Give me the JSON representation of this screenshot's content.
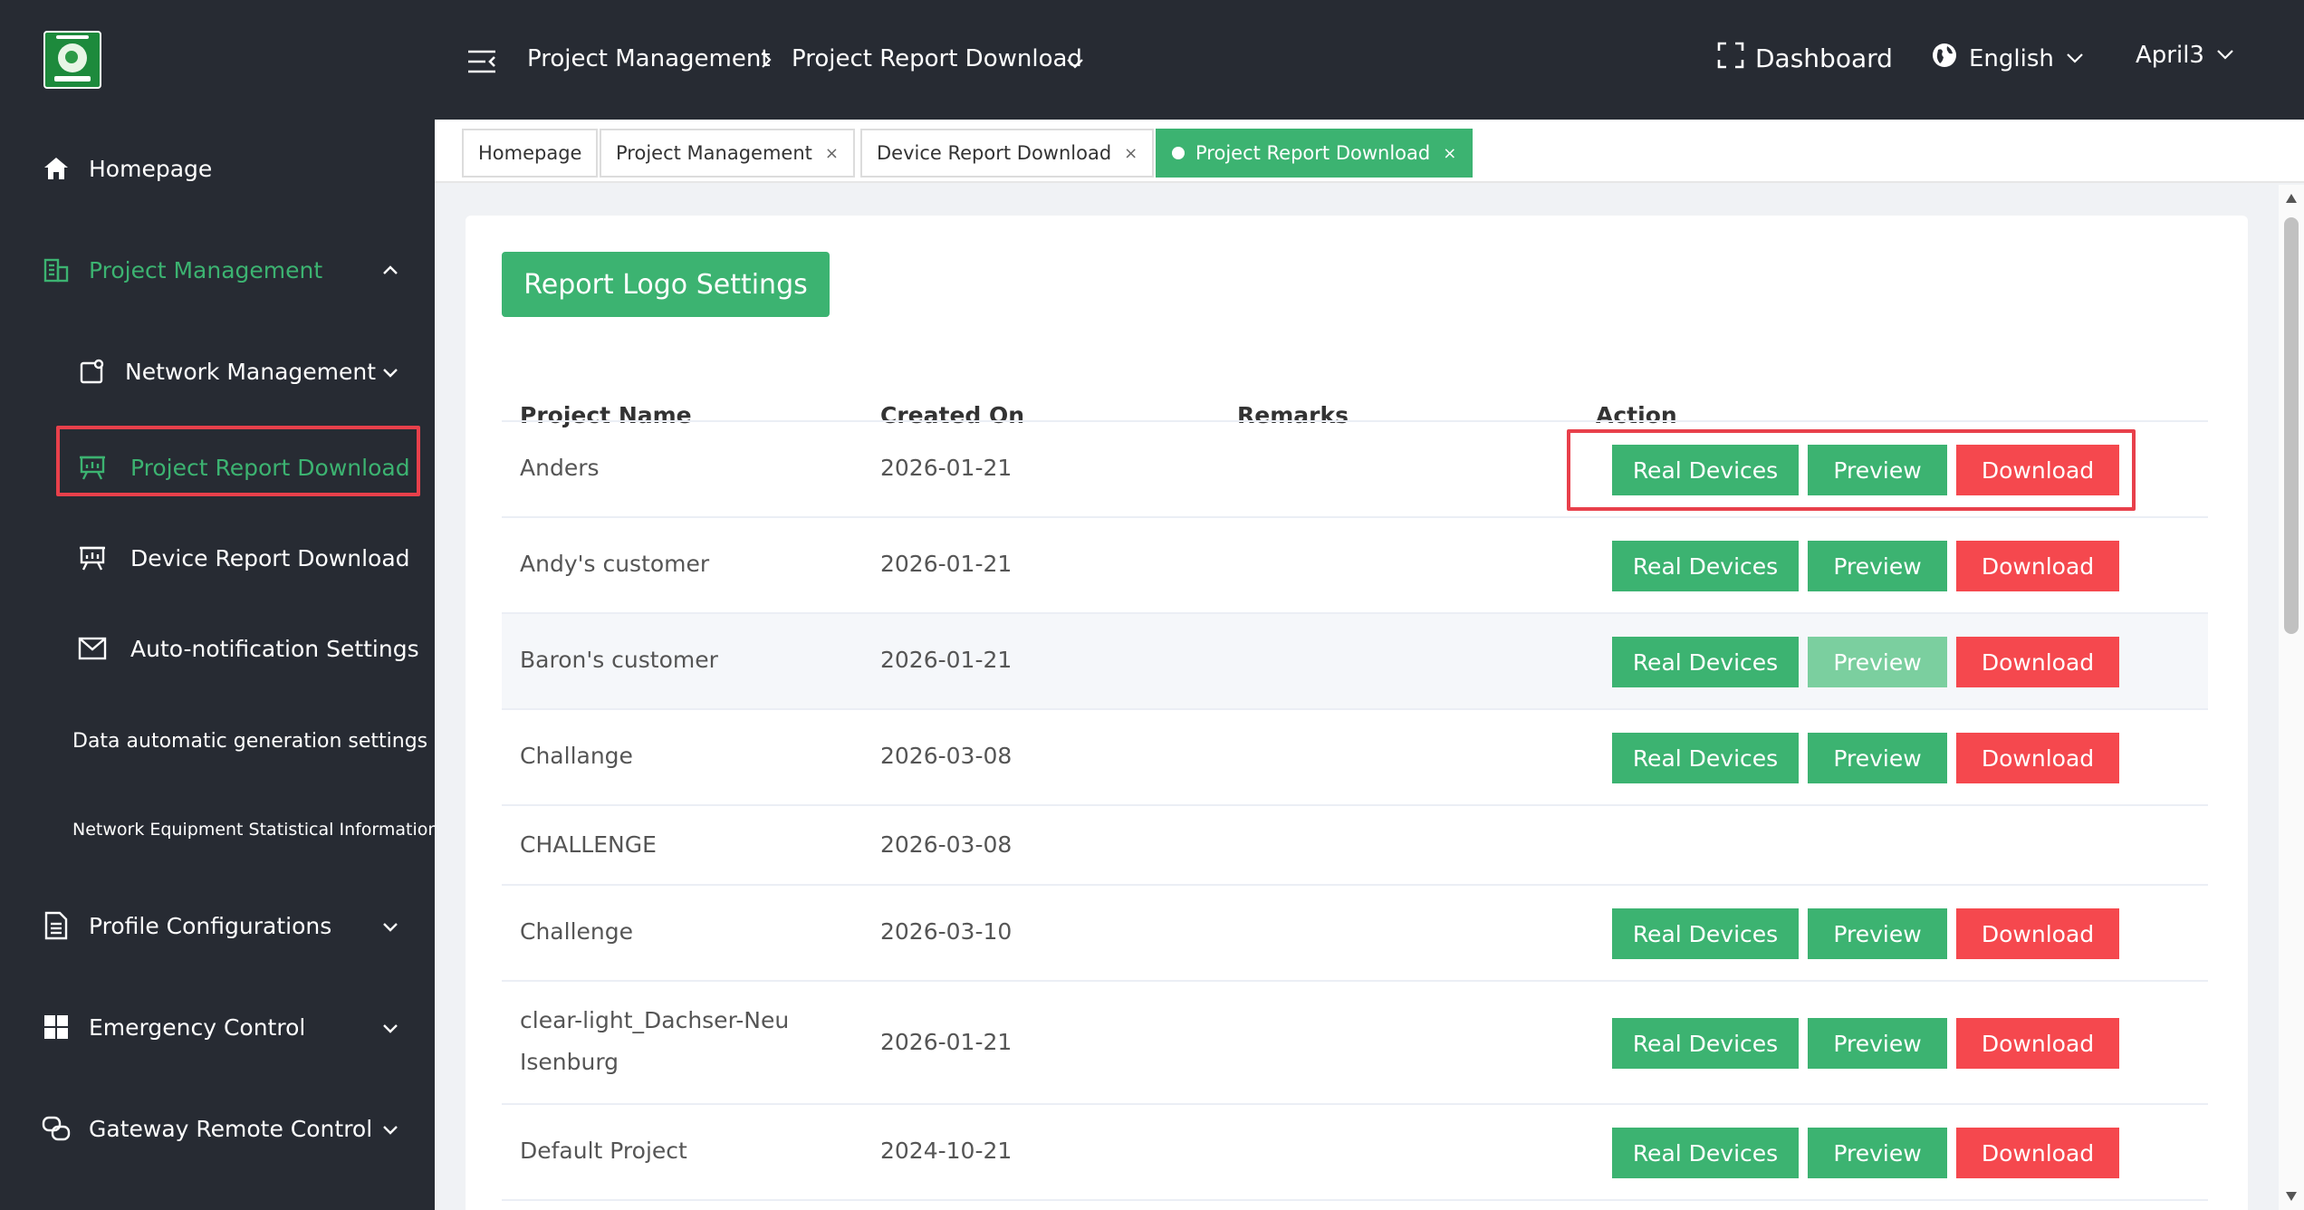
{
  "sidebar": {
    "items": [
      {
        "label": "Homepage",
        "icon": "home-icon"
      },
      {
        "label": "Project Management",
        "icon": "building-icon"
      },
      {
        "label": "Network Management",
        "icon": "network-icon"
      },
      {
        "label": "Project Report Download",
        "icon": "presentation-icon"
      },
      {
        "label": "Device Report Download",
        "icon": "presentation-icon"
      },
      {
        "label": "Auto-notification Settings",
        "icon": "mail-icon"
      },
      {
        "label": "Data automatic generation settings"
      },
      {
        "label": "Network Equipment Statistical Information"
      },
      {
        "label": "Profile Configurations",
        "icon": "document-icon"
      },
      {
        "label": "Emergency Control",
        "icon": "grid-icon"
      },
      {
        "label": "Gateway Remote Control",
        "icon": "link-icon"
      }
    ]
  },
  "header": {
    "breadcrumb_1": "Project Management",
    "breadcrumb_2": "Project Report Download",
    "dashboard": "Dashboard",
    "language": "English",
    "user": "April3"
  },
  "tabs": [
    {
      "label": "Homepage"
    },
    {
      "label": "Project Management",
      "close": "×"
    },
    {
      "label": "Device Report Download",
      "close": "×"
    },
    {
      "label": "Project Report Download",
      "close": "×"
    }
  ],
  "main": {
    "logo_settings_button": "Report Logo Settings",
    "columns": [
      "Project Name",
      "Created On",
      "Remarks",
      "Action"
    ],
    "actions": {
      "real_devices": "Real Devices",
      "preview": "Preview",
      "download": "Download"
    },
    "rows": [
      {
        "name": "Anders",
        "created": "2026-01-21",
        "remarks": ""
      },
      {
        "name": "Andy's customer",
        "created": "2026-01-21",
        "remarks": ""
      },
      {
        "name": "Baron's customer",
        "created": "2026-01-21",
        "remarks": ""
      },
      {
        "name": "Challange",
        "created": "2026-03-08",
        "remarks": ""
      },
      {
        "name": "CHALLENGE",
        "created": "2026-03-08",
        "remarks": ""
      },
      {
        "name": "Challenge",
        "created": "2026-03-10",
        "remarks": ""
      },
      {
        "name": "clear-light_Dachser-Neu Isenburg",
        "created": "2026-01-21",
        "remarks": ""
      },
      {
        "name": "Default Project",
        "created": "2024-10-21",
        "remarks": ""
      }
    ]
  },
  "colors": {
    "accent": "#3cb371",
    "danger": "#f5484e",
    "sidebar_bg": "#272b33",
    "highlight": "#e8404b"
  }
}
